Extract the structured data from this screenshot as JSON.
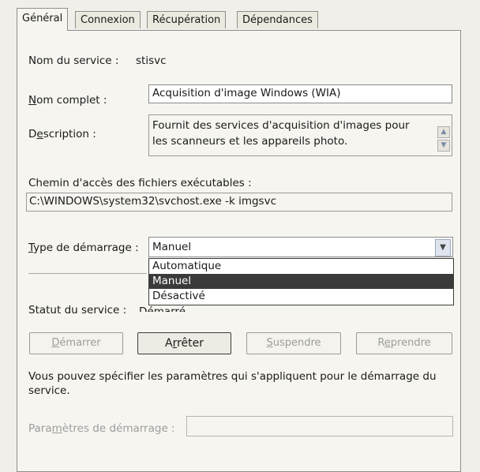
{
  "tabs": [
    {
      "label": "Général"
    },
    {
      "label": "Connexion"
    },
    {
      "label": "Récupération"
    },
    {
      "label": "Dépendances"
    }
  ],
  "service_name": {
    "label": "Nom du service :",
    "value": "stisvc"
  },
  "display_name": {
    "label": "Nom complet :",
    "value": "Acquisition d'image Windows (WIA)"
  },
  "description": {
    "label": "Description :",
    "line1": "Fournit des services d'acquisition d'images pour",
    "line2": "les scanneurs et les appareils photo."
  },
  "executable_path": {
    "label": "Chemin d'accès des fichiers exécutables :",
    "value": "C:\\WINDOWS\\system32\\svchost.exe -k imgsvc"
  },
  "startup_type": {
    "label": "Type de démarrage :",
    "selected": "Manuel",
    "options": [
      "Automatique",
      "Manuel",
      "Désactivé"
    ]
  },
  "service_status": {
    "label": "Statut du service :",
    "value": "Démarré"
  },
  "buttons": {
    "start": "Démarrer",
    "stop": "Arrêter",
    "pause": "Suspendre",
    "resume": "Reprendre"
  },
  "hint_text": "Vous pouvez spécifier les paramètres qui s'appliquent pour le démarrage du service.",
  "start_params": {
    "label": "Paramètres de démarrage :",
    "value": ""
  },
  "colors": {
    "selected_option": "#3a3a3a",
    "disabled_text": "#9c9c9c",
    "panel_bg": "#f6f5f0"
  }
}
